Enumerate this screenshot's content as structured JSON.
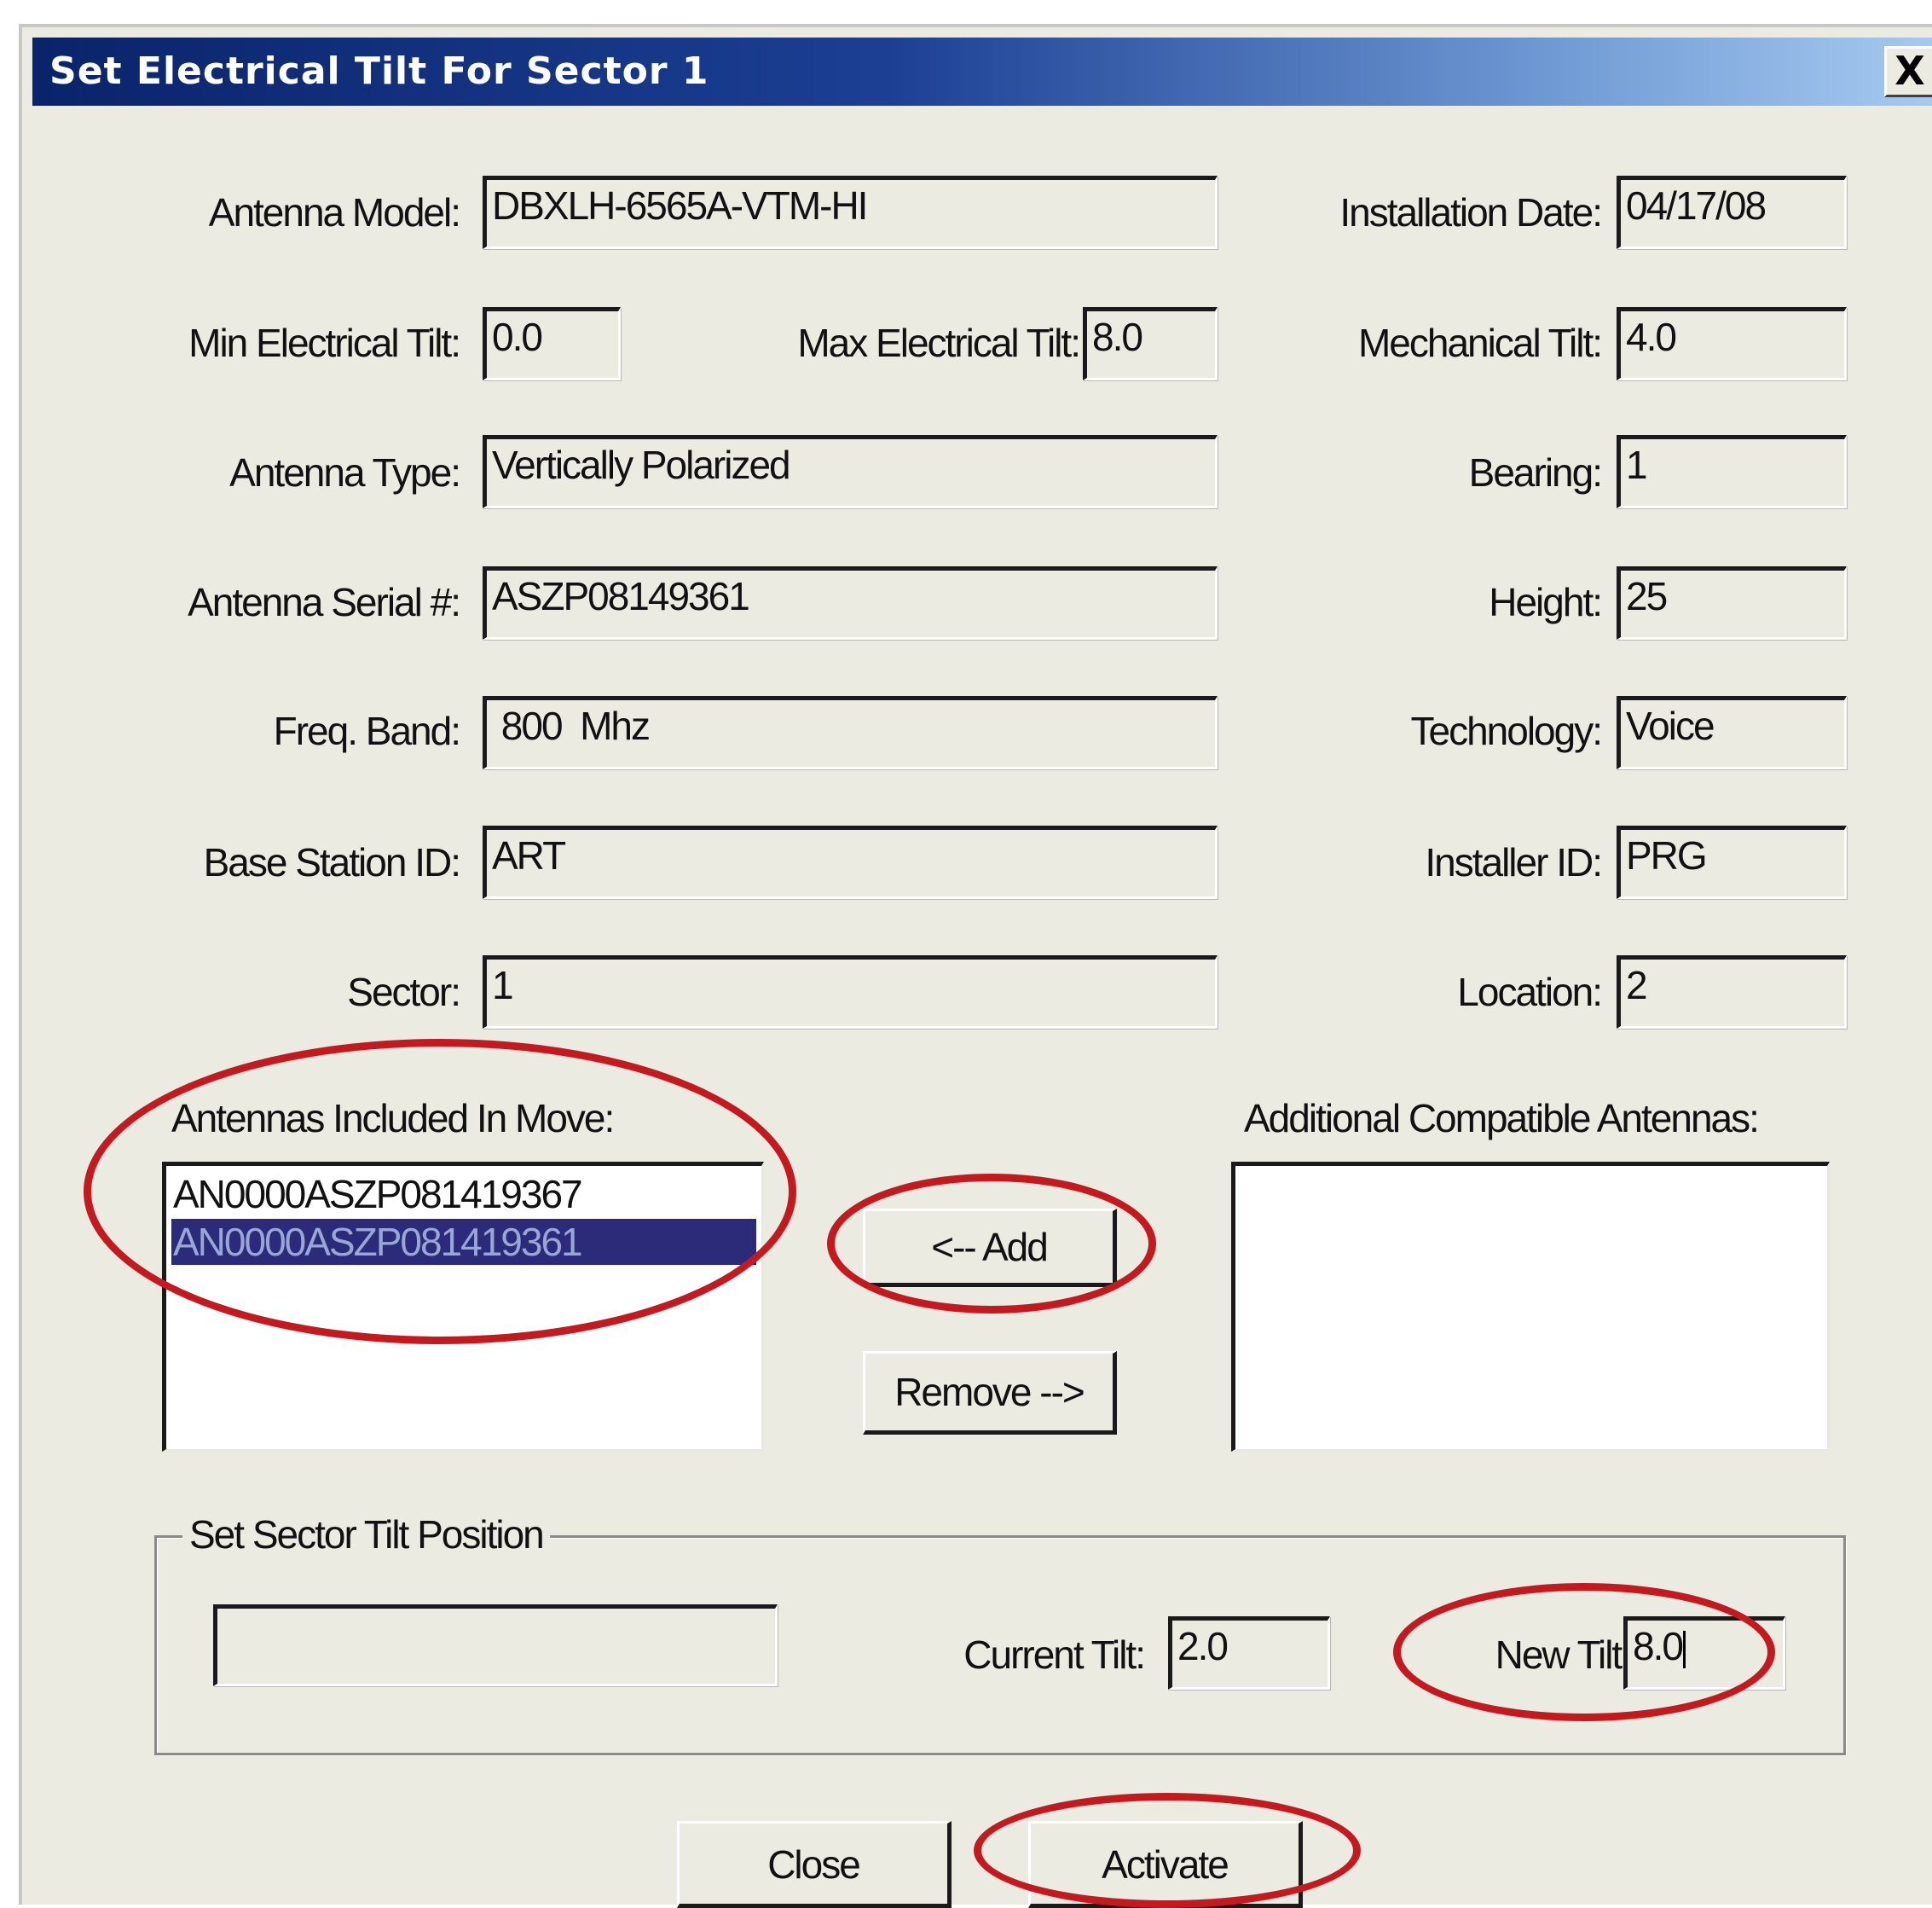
{
  "window": {
    "title": "Set Electrical Tilt For Sector 1",
    "close_glyph": "X"
  },
  "fields": {
    "antenna_model": {
      "label": "Antenna Model:",
      "value": "DBXLH-6565A-VTM-HI"
    },
    "installation_date": {
      "label": "Installation Date:",
      "value": "04/17/08"
    },
    "min_electrical_tilt": {
      "label": "Min Electrical Tilt:",
      "value": "0.0"
    },
    "max_electrical_tilt": {
      "label": "Max Electrical Tilt:",
      "value": "8.0"
    },
    "mechanical_tilt": {
      "label": "Mechanical Tilt:",
      "value": "4.0"
    },
    "antenna_type": {
      "label": "Antenna Type:",
      "value": "Vertically Polarized"
    },
    "bearing": {
      "label": "Bearing:",
      "value": "1"
    },
    "antenna_serial": {
      "label": "Antenna Serial #:",
      "value": "ASZP08149361"
    },
    "height": {
      "label": "Height:",
      "value": "25"
    },
    "freq_band": {
      "label": "Freq. Band:",
      "value": " 800  Mhz"
    },
    "technology": {
      "label": "Technology:",
      "value": "Voice"
    },
    "base_station_id": {
      "label": "Base Station ID:",
      "value": "ART"
    },
    "installer_id": {
      "label": "Installer ID:",
      "value": "PRG"
    },
    "sector": {
      "label": "Sector:",
      "value": "1"
    },
    "location": {
      "label": "Location:",
      "value": "2"
    }
  },
  "antennas_included": {
    "label": "Antennas Included In Move:",
    "items": [
      {
        "text": "AN0000ASZP081419367",
        "selected": false
      },
      {
        "text": "AN0000ASZP081419361",
        "selected": true
      }
    ]
  },
  "additional_antennas": {
    "label": "Additional Compatible Antennas:",
    "items": []
  },
  "buttons": {
    "add": "<-- Add",
    "remove": "Remove -->",
    "close": "Close",
    "activate": "Activate"
  },
  "tilt_group": {
    "legend": "Set Sector Tilt Position",
    "status_value": "",
    "current_tilt": {
      "label": "Current Tilt:",
      "value": "2.0"
    },
    "new_tilt": {
      "label": "New Tilt:",
      "value": "8.0"
    }
  },
  "colors": {
    "dialog_background": "#ecebe2",
    "titlebar_start": "#0a246a",
    "titlebar_end": "#a6caf0",
    "selection_background": "#2b2b7a",
    "callout_circle": "#c4191f"
  },
  "icons": {
    "close": "close-icon"
  }
}
